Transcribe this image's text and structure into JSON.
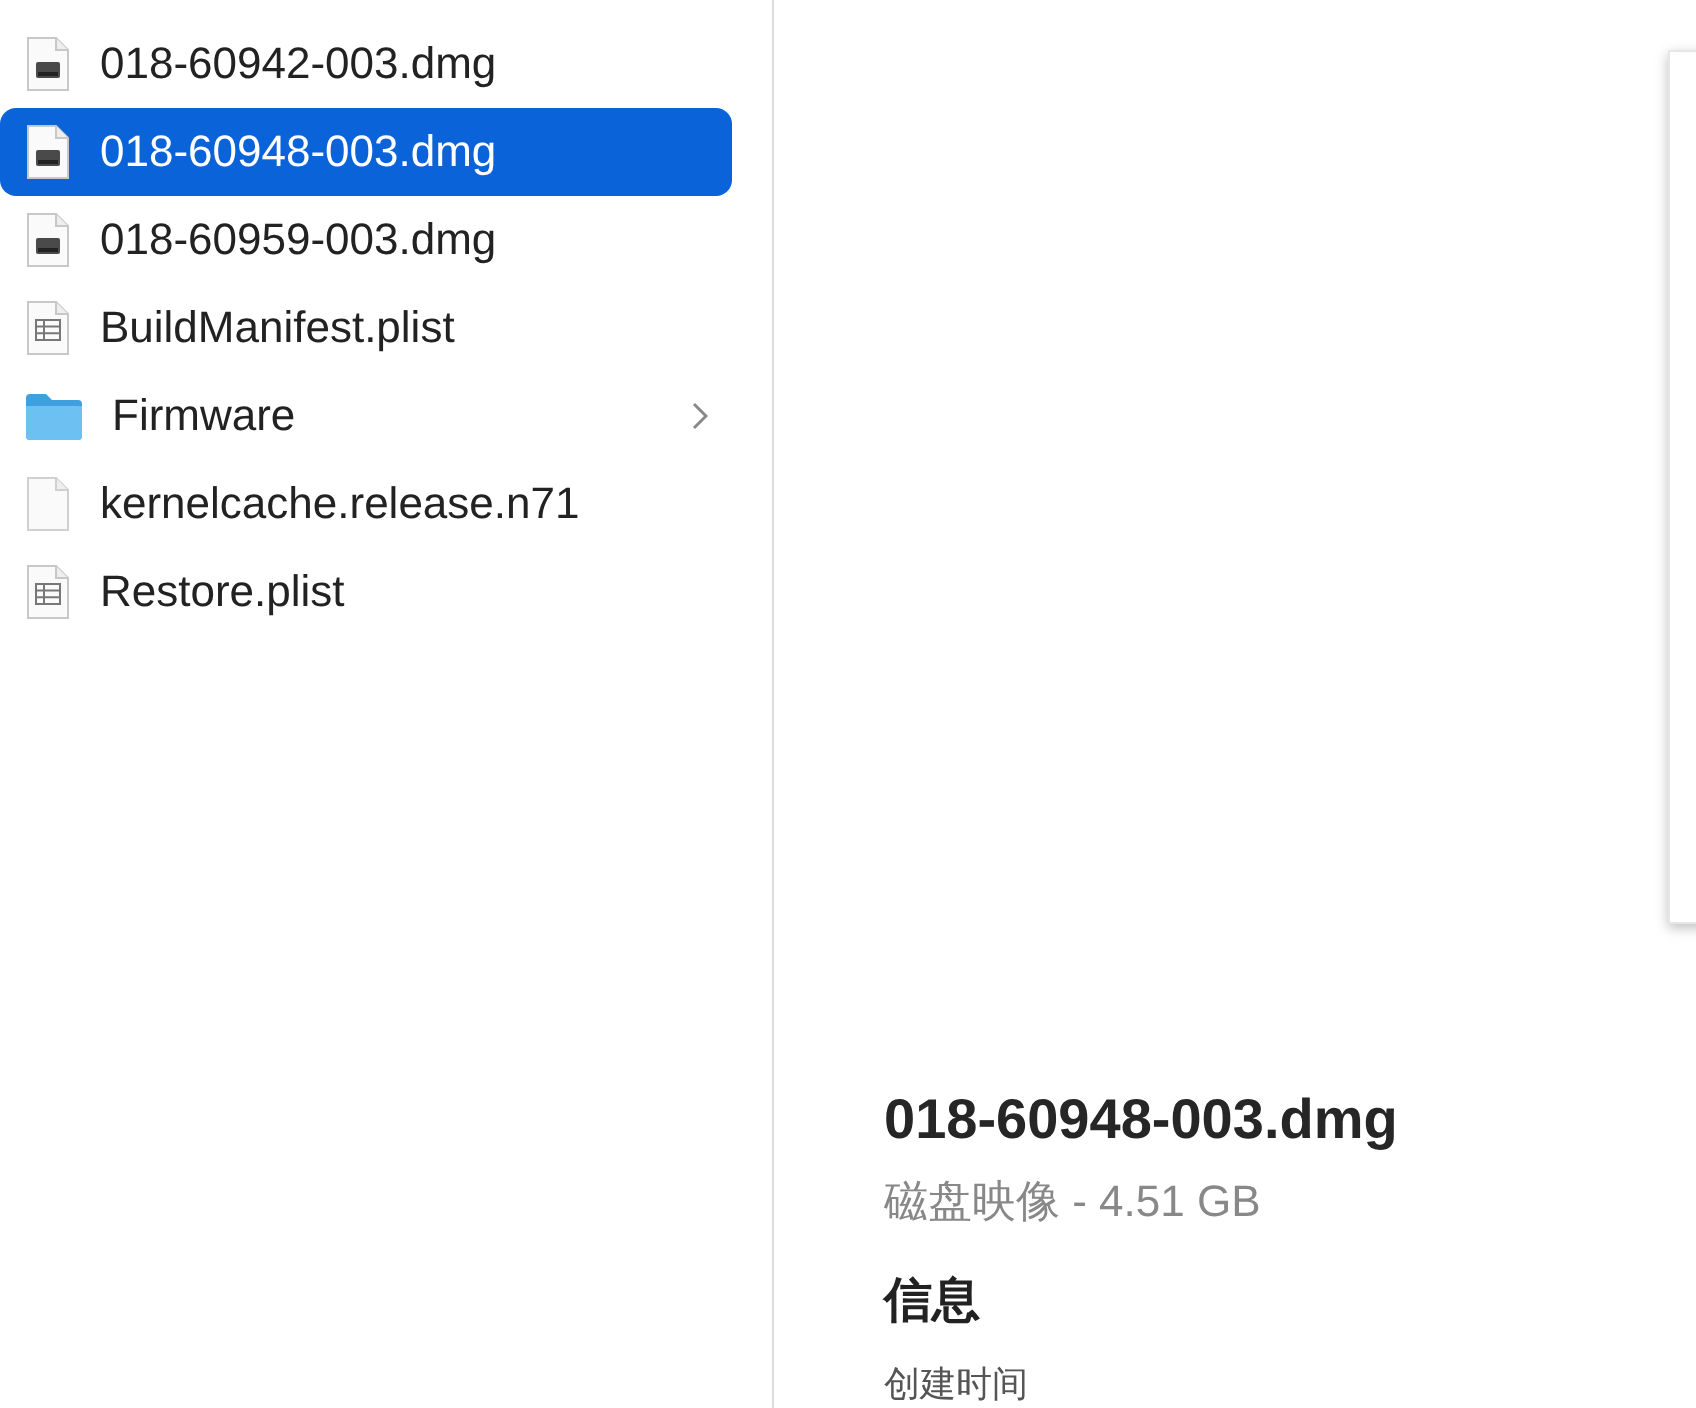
{
  "files": [
    {
      "name": "018-60942-003.dmg",
      "kind": "dmg",
      "selected": false
    },
    {
      "name": "018-60948-003.dmg",
      "kind": "dmg",
      "selected": true
    },
    {
      "name": "018-60959-003.dmg",
      "kind": "dmg",
      "selected": false
    },
    {
      "name": "BuildManifest.plist",
      "kind": "plist",
      "selected": false
    },
    {
      "name": "Firmware",
      "kind": "folder",
      "selected": false
    },
    {
      "name": "kernelcache.release.n71",
      "kind": "file",
      "selected": false
    },
    {
      "name": "Restore.plist",
      "kind": "plist",
      "selected": false
    }
  ],
  "preview": {
    "title": "018-60948-003.dmg",
    "subtitle": "磁盘映像 - 4.51 GB",
    "section": "信息",
    "field_label": "创建时间"
  }
}
